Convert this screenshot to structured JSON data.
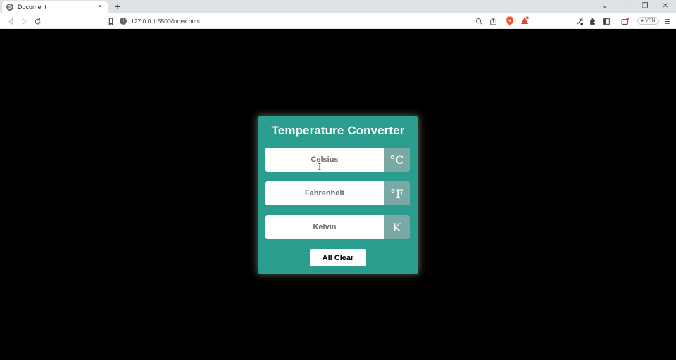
{
  "browser": {
    "tab_title": "Document",
    "tab_close": "×",
    "new_tab": "+",
    "url": "127.0.0.1:5500/index.html",
    "vpn_label": "● VPN",
    "window_controls": {
      "chevron": "⌄",
      "minimize": "–",
      "restore": "❐",
      "close": "✕"
    },
    "colors": {
      "tabbar": "#dee1e6",
      "toolbar": "#ffffff"
    }
  },
  "converter": {
    "title": "Temperature Converter",
    "fields": [
      {
        "placeholder": "Celsius",
        "unit": "°C"
      },
      {
        "placeholder": "Fahrenheit",
        "unit": "°F"
      },
      {
        "placeholder": "Kelvin",
        "unit": "K"
      }
    ],
    "clear_label": "All Clear",
    "colors": {
      "card": "#2a9d8f",
      "unit_box": "#7aa9a5",
      "background": "#000000"
    }
  }
}
